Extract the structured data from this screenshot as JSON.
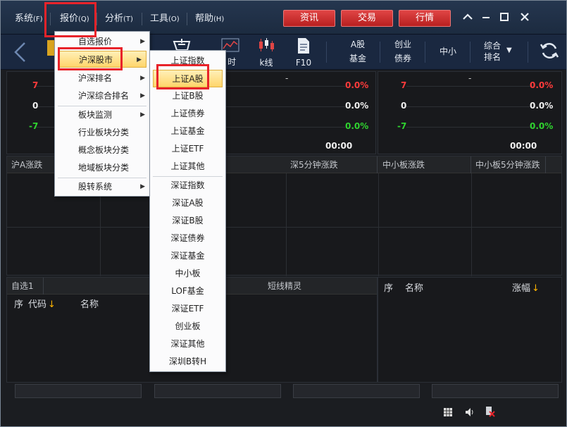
{
  "menubar": {
    "items": [
      {
        "label": "系统",
        "key": "(F)"
      },
      {
        "label": "报价",
        "key": "(Q)"
      },
      {
        "label": "分析",
        "key": "(T)"
      },
      {
        "label": "工具",
        "key": "(O)"
      },
      {
        "label": "帮助",
        "key": "(H)"
      }
    ],
    "buttons": [
      "资讯",
      "交易",
      "行情"
    ]
  },
  "toolbar": {
    "items": [
      {
        "label": "时"
      },
      {
        "label": "k线"
      },
      {
        "label": "F10"
      }
    ],
    "two_line": [
      {
        "top": "A股",
        "bottom": "基金"
      },
      {
        "top": "创业",
        "bottom": "债券"
      },
      {
        "top": "中小",
        "bottom": ""
      },
      {
        "top": "综合",
        "bottom": "排名"
      }
    ]
  },
  "charts": {
    "left": {
      "dash": "-",
      "labels": [
        "7",
        "0",
        "-7"
      ],
      "pcts": [
        "0.0%",
        "0.0%",
        "0.0%"
      ],
      "time": "00:00"
    },
    "right": {
      "dash": "-",
      "labels": [
        "7",
        "0",
        "-7"
      ],
      "pcts": [
        "0.0%",
        "0.0%",
        "0.0%"
      ],
      "time": "00:00"
    }
  },
  "panel_headers": [
    "沪A涨跌",
    "深5分钟涨跌",
    "中小板涨跌",
    "中小板5分钟涨跌"
  ],
  "bottom_left": {
    "tab": "自选1",
    "center_tab": "短线精灵",
    "col_seq": "序",
    "col_code": "代码",
    "col_name": "名称"
  },
  "bottom_right": {
    "col_seq": "序",
    "col_name": "名称",
    "col_change": "涨幅"
  },
  "dropdown_main": {
    "items": [
      {
        "label": "自选报价",
        "arrow": true
      },
      {
        "label": "沪深股市",
        "arrow": true
      },
      {
        "label": "沪深排名",
        "arrow": true
      },
      {
        "label": "沪深综合排名",
        "arrow": true
      },
      {
        "label": "板块监测",
        "arrow": true
      },
      {
        "label": "行业板块分类",
        "arrow": false
      },
      {
        "label": "概念板块分类",
        "arrow": false
      },
      {
        "label": "地域板块分类",
        "arrow": false
      },
      {
        "label": "股转系统",
        "arrow": true
      }
    ]
  },
  "dropdown_sub": {
    "items": [
      "上证指数",
      "上证A股",
      "上证B股",
      "上证债券",
      "上证基金",
      "上证ETF",
      "上证其他",
      "深证指数",
      "深证A股",
      "深证B股",
      "深证债券",
      "深证基金",
      "中小板",
      "LOF基金",
      "深证ETF",
      "创业板",
      "深证其他",
      "深圳B转H"
    ]
  },
  "colors": {
    "accent_red": "#e8232a",
    "up": "#ff3b3b",
    "down": "#2fd32f",
    "highlight": "#ffd56a"
  }
}
